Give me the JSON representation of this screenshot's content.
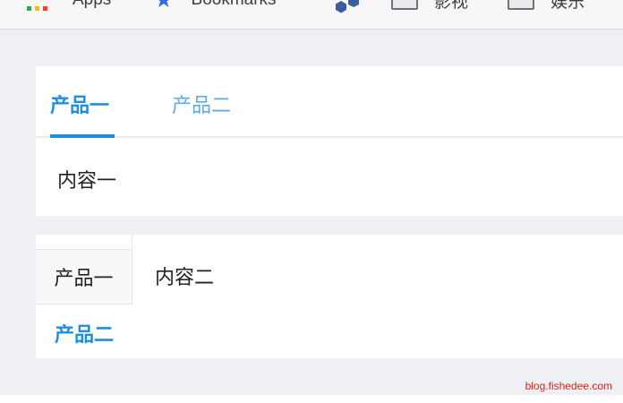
{
  "bookmarks_bar": {
    "apps_label": "Apps",
    "bookmarks_label": "Bookmarks",
    "folders": [
      "影视",
      "娱乐"
    ]
  },
  "horizontal_tabs": {
    "tabs": [
      "产品一",
      "产品二"
    ],
    "active_index": 0,
    "content": "内容一"
  },
  "vertical_tabs": {
    "tabs": [
      "产品一",
      "产品二"
    ],
    "active_index": 1,
    "content": "内容二"
  },
  "watermark": "blog.fishedee.com",
  "colors": {
    "accent": "#1e8fe1",
    "page_background": "#eff0f3",
    "watermark": "#e0201c"
  }
}
